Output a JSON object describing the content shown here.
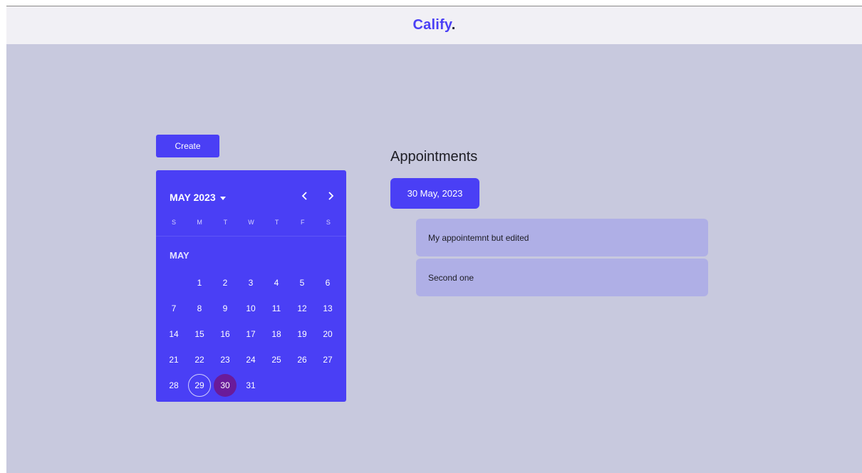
{
  "header": {
    "brand": "Calify",
    "brand_dot": "."
  },
  "create_button": {
    "label": "Create"
  },
  "calendar": {
    "month_year": "MAY 2023",
    "weekdays": [
      "S",
      "M",
      "T",
      "W",
      "T",
      "F",
      "S"
    ],
    "month_label": "MAY",
    "weeks": [
      [
        "",
        "1",
        "2",
        "3",
        "4",
        "5",
        "6"
      ],
      [
        "7",
        "8",
        "9",
        "10",
        "11",
        "12",
        "13"
      ],
      [
        "14",
        "15",
        "16",
        "17",
        "18",
        "19",
        "20"
      ],
      [
        "21",
        "22",
        "23",
        "24",
        "25",
        "26",
        "27"
      ],
      [
        "28",
        "29",
        "30",
        "31",
        "",
        "",
        ""
      ]
    ],
    "today": "29",
    "selected": "30",
    "colors": {
      "accent": "#4a3ff5",
      "selected": "#6a1b9a"
    }
  },
  "appointments": {
    "title": "Appointments",
    "date_chip": "30 May, 2023",
    "items": [
      {
        "text": "My appointemnt but edited"
      },
      {
        "text": "Second one"
      }
    ]
  },
  "colors": {
    "background": "#c8c9de",
    "header": "#f1f0f5",
    "appointment_card": "#afafe6"
  }
}
